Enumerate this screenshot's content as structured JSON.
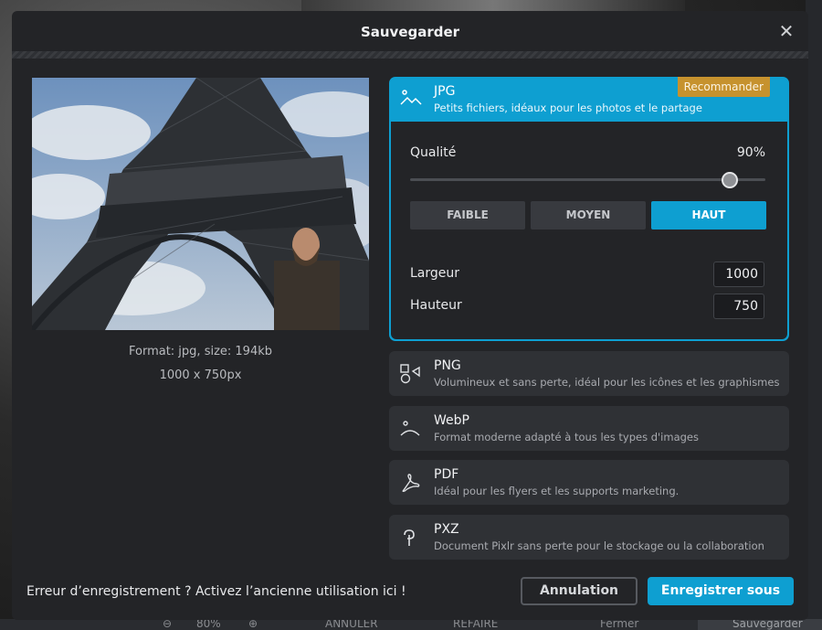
{
  "dialog": {
    "title": "Sauvegarder",
    "close_icon": "close-icon"
  },
  "preview": {
    "format_info": "Format: jpg, size: 194kb",
    "dimensions": "1000 x 750px"
  },
  "formats": {
    "jpg": {
      "name": "JPG",
      "description": "Petits fichiers, idéaux pour les photos et le partage",
      "badge": "Recommander",
      "icon": "image-mountain-icon",
      "quality_label": "Qualité",
      "quality_value": "90%",
      "quality_level": 0.9,
      "quality_buttons": [
        "FAIBLE",
        "MOYEN",
        "HAUT"
      ],
      "active_quality": "HAUT",
      "width_label": "Largeur",
      "width_value": "1000",
      "height_label": "Hauteur",
      "height_value": "750"
    },
    "png": {
      "name": "PNG",
      "description": "Volumineux et sans perte, idéal pour les icônes et les graphismes",
      "icon": "shapes-icon"
    },
    "webp": {
      "name": "WebP",
      "description": "Format moderne adapté à tous les types d'images",
      "icon": "smile-icon"
    },
    "pdf": {
      "name": "PDF",
      "description": "Idéal pour les flyers et les supports marketing.",
      "icon": "pdf-icon"
    },
    "pxz": {
      "name": "PXZ",
      "description": "Document Pixlr sans perte pour le stockage ou la collaboration",
      "icon": "pixlr-icon"
    }
  },
  "footer": {
    "legacy_link": "Erreur d’enregistrement ? Activez l’ancienne utilisation ici !",
    "cancel_label": "Annulation",
    "save_label": "Enregistrer sous"
  },
  "background_app": {
    "zoom": "80%",
    "undo_label": "ANNULER",
    "redo_label": "REFAIRE",
    "close_label": "Fermer",
    "save_label": "Sauvegarder"
  },
  "colors": {
    "accent": "#0e9fd1",
    "badge": "#c6922e",
    "dialog_bg": "#232427"
  }
}
